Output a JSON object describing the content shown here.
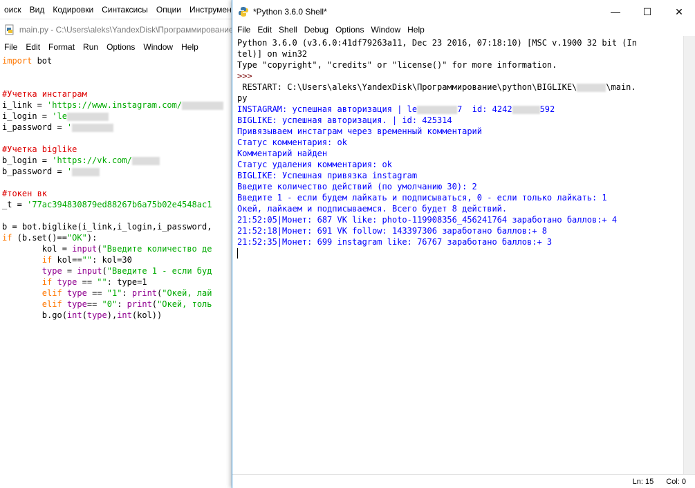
{
  "background_app": {
    "menu": [
      "оиск",
      "Вид",
      "Кодировки",
      "Синтаксисы",
      "Опции",
      "Инструмен"
    ]
  },
  "editor": {
    "title": "main.py - C:\\Users\\aleks\\YandexDisk\\Программирование",
    "menu": [
      "File",
      "Edit",
      "Format",
      "Run",
      "Options",
      "Window",
      "Help"
    ],
    "code": {
      "l1_kw": "import",
      "l1_rest": " bot",
      "l4": "#Учетка инстаграм",
      "l5_a": "i_link = ",
      "l5_b": "'https://www.instagram.com/",
      "l6_a": "i_login = ",
      "l6_b": "'le",
      "l7_a": "i_password = ",
      "l7_b": "'",
      "l9": "#Учетка biglike",
      "l10_a": "b_login = ",
      "l10_b": "'https://vk.com/",
      "l11_a": "b_password = ",
      "l11_b": "'",
      "l13": "#токен вк",
      "l14_a": "_t = ",
      "l14_b": "'77ac394830879ed88267b6a75b02e4548ac1",
      "l16": "b = bot.biglike(i_link,i_login,i_password,",
      "l17_kw": "if",
      "l17_rest": " (b.set()==",
      "l17_str": "\"OK\"",
      "l17_end": "):",
      "l18_a": "        kol = ",
      "l18_b": "input",
      "l18_c": "(",
      "l18_d": "\"Введите количество де",
      "l19_kw": "        if",
      "l19_rest": " kol==",
      "l19_str": "\"\"",
      "l19_end": ": kol=30",
      "l20_a": "        ",
      "l20_b": "type",
      "l20_c": " = ",
      "l20_d": "input",
      "l20_e": "(",
      "l20_f": "\"Введите 1 - если буд",
      "l21_kw": "        if",
      "l21_sp": " ",
      "l21_bi": "type",
      "l21_rest": " == ",
      "l21_str": "\"\"",
      "l21_end": ": type=1",
      "l22_kw": "        elif",
      "l22_sp": " ",
      "l22_bi": "type",
      "l22_rest": " == ",
      "l22_str": "\"1\"",
      "l22_c": ": ",
      "l22_p": "print",
      "l22_d": "(",
      "l22_s2": "\"Окей, лай",
      "l23_kw": "        elif",
      "l23_sp": " ",
      "l23_bi": "type",
      "l23_rest": "== ",
      "l23_str": "\"0\"",
      "l23_c": ": ",
      "l23_p": "print",
      "l23_d": "(",
      "l23_s2": "\"Окей, толь",
      "l24_a": "        b.go(",
      "l24_b": "int",
      "l24_c": "(",
      "l24_d": "type",
      "l24_e": "),",
      "l24_f": "int",
      "l24_g": "(kol))"
    }
  },
  "shell": {
    "title": "*Python 3.6.0 Shell*",
    "controls": {
      "minimize": "—",
      "maximize": "☐",
      "close": "✕"
    },
    "menu": [
      "File",
      "Edit",
      "Shell",
      "Debug",
      "Options",
      "Window",
      "Help"
    ],
    "lines": [
      "Python 3.6.0 (v3.6.0:41df79263a11, Dec 23 2016, 07:18:10) [MSC v.1900 32 bit (In",
      "tel)] on win32",
      "Type \"copyright\", \"credits\" or \"license()\" for more information.",
      ">>> ",
      " RESTART: C:\\Users\\aleks\\YandexDisk\\Программирование\\python\\BIGLIKE\\",
      "\\main.",
      "py",
      "INSTAGRAM: успешная авторизация | le",
      "7  id: 4242",
      "592",
      "BIGLIKE: успешная авторизация. | id: 425314",
      "Привязываем инстаграм через временный комментарий",
      "Статус комментария: ok",
      "Комментарий найден",
      "Статус удаления комментария: ok",
      "BIGLIKE: Успешная привязка instagram",
      "Введите количество действий (по умолчанию 30): 2",
      "Введите 1 - если будем лайкать и подписываться, 0 - если только лайкать: 1",
      "Окей, лайкаем и подписываемся. Всего будет 8 действий.",
      "21:52:05|Монет: 687 VK like: photo-119908356_456241764 заработано баллов:+ 4",
      "21:52:18|Монет: 691 VK follow: 143397306 заработано баллов:+ 8",
      "21:52:35|Монет: 699 instagram like: 76767 заработано баллов:+ 3"
    ],
    "status": {
      "line": "Ln: 15",
      "col": "Col: 0"
    }
  }
}
